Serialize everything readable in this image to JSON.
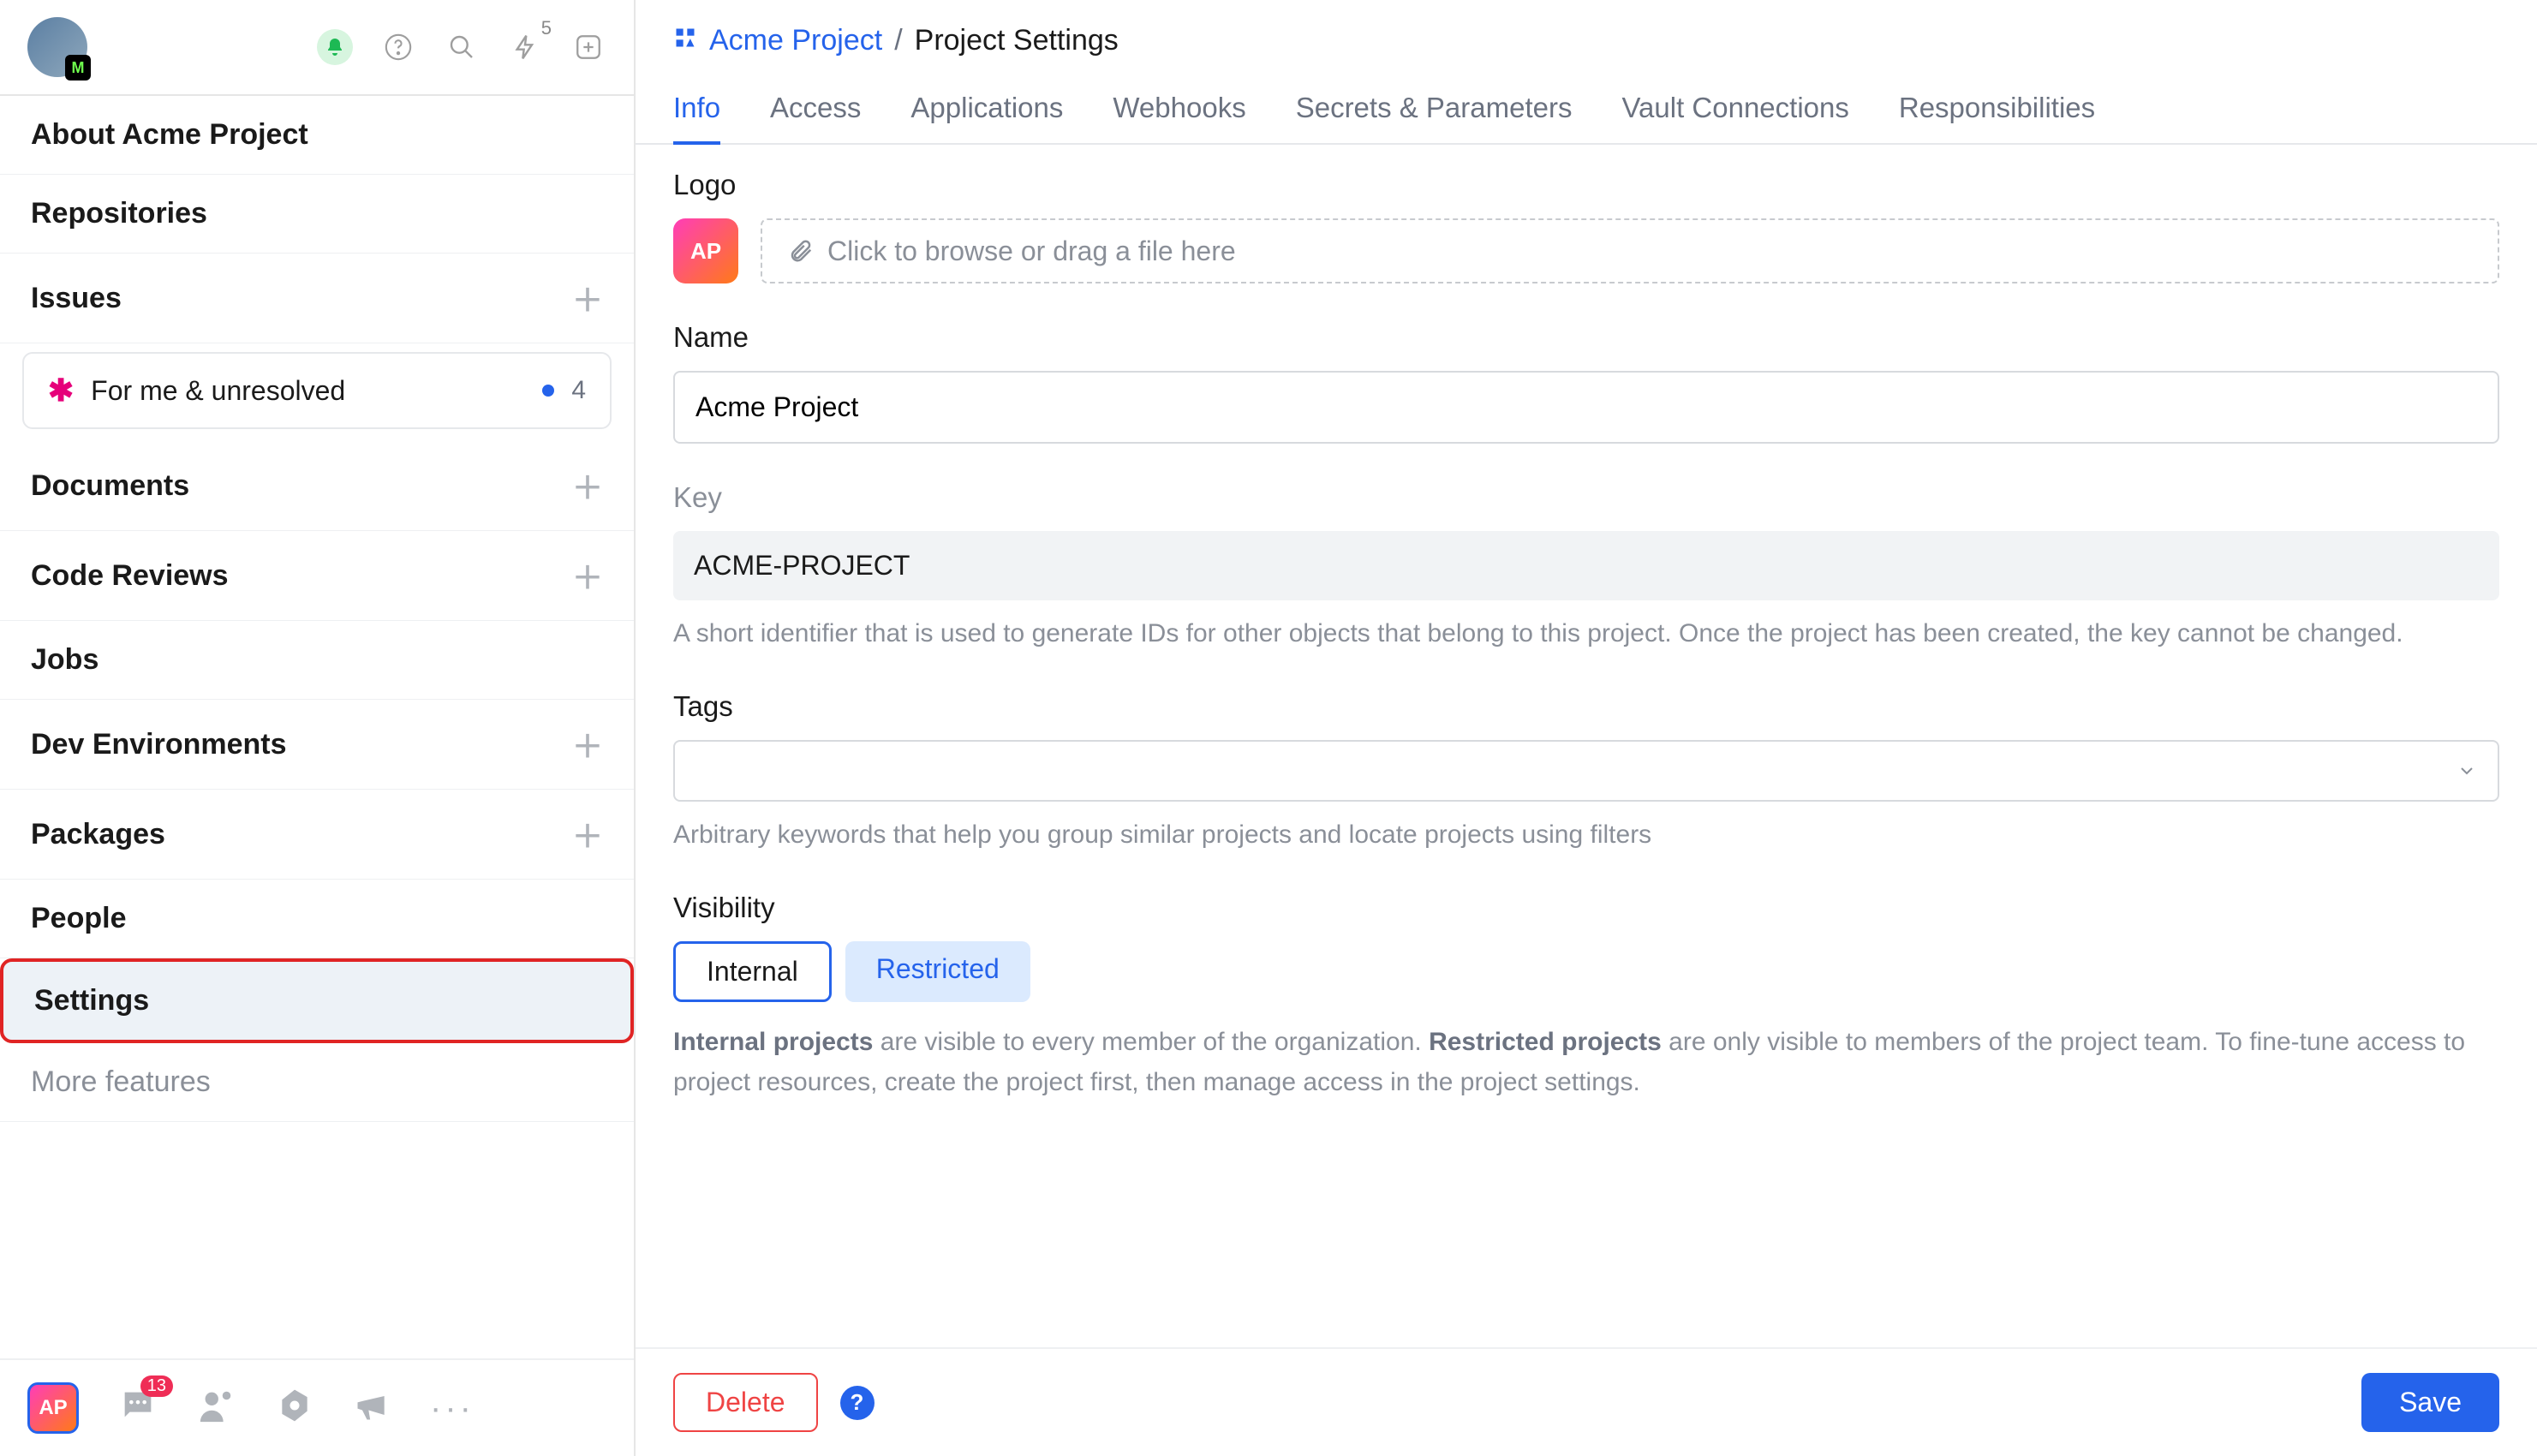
{
  "topbar": {
    "avatar_badge": "M",
    "lightning_badge": "5"
  },
  "sidebar": {
    "items": [
      {
        "label": "About Acme Project",
        "plus": false
      },
      {
        "label": "Repositories",
        "plus": false
      },
      {
        "label": "Issues",
        "plus": true
      },
      {
        "label": "Documents",
        "plus": true
      },
      {
        "label": "Code Reviews",
        "plus": true
      },
      {
        "label": "Jobs",
        "plus": false
      },
      {
        "label": "Dev Environments",
        "plus": true
      },
      {
        "label": "Packages",
        "plus": true
      },
      {
        "label": "People",
        "plus": false
      },
      {
        "label": "Settings",
        "plus": false
      },
      {
        "label": "More features",
        "plus": false
      }
    ],
    "issues_sub": {
      "label": "For me & unresolved",
      "count": "4"
    }
  },
  "bottombar": {
    "project_chip": "AP",
    "chat_badge": "13"
  },
  "breadcrumb": {
    "link": "Acme Project",
    "sep": "/",
    "current": "Project Settings"
  },
  "tabs": [
    "Info",
    "Access",
    "Applications",
    "Webhooks",
    "Secrets & Parameters",
    "Vault Connections",
    "Responsibilities"
  ],
  "form": {
    "logo_label": "Logo",
    "logo_chip": "AP",
    "dropzone": "Click to browse or drag a file here",
    "name_label": "Name",
    "name_value": "Acme Project",
    "key_label": "Key",
    "key_value": "ACME-PROJECT",
    "key_help": "A short identifier that is used to generate IDs for other objects that belong to this project. Once the project has been created, the key cannot be changed.",
    "tags_label": "Tags",
    "tags_help": "Arbitrary keywords that help you group similar projects and locate projects using filters",
    "visibility_label": "Visibility",
    "visibility_options": [
      "Internal",
      "Restricted"
    ],
    "visibility_help_pre": "Internal projects",
    "visibility_help_mid": " are visible to every member of the organization. ",
    "visibility_help_bold2": "Restricted projects",
    "visibility_help_post": " are only visible to members of the project team. To fine-tune access to project resources, create the project first, then manage access in the project settings."
  },
  "footer": {
    "delete": "Delete",
    "help": "?",
    "save": "Save"
  }
}
